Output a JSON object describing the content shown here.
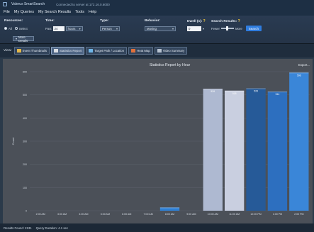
{
  "window": {
    "app_name": "Valerus SmartSearch",
    "connection_status": "Connected to server at 172.16.0.6000"
  },
  "menu": [
    "File",
    "My Queries",
    "My Search Results",
    "Tools",
    "Help"
  ],
  "filters": {
    "resources": {
      "label": "Resources:",
      "options": [
        "All",
        "Select"
      ],
      "selected": "All"
    },
    "time": {
      "label": "Time:",
      "prefix": "Past",
      "amount": "24",
      "unit": "hours"
    },
    "type": {
      "label": "Type:",
      "value": "Person"
    },
    "behavior": {
      "label": "Behavior:",
      "value": "Moving"
    },
    "dwell": {
      "label": "Dwell (s):",
      "value": "0"
    },
    "search_results": {
      "label": "Search Results:",
      "min_label": "Fewer",
      "max_label": "More"
    },
    "search_button": "Search",
    "more_details_button": "More Details"
  },
  "view": {
    "label": "View:",
    "tabs": [
      {
        "label": "Event Thumbnails",
        "icon": "thumbnails-icon",
        "color": "#e3b84a",
        "active": false
      },
      {
        "label": "Statistics Report",
        "icon": "statistics-icon",
        "color": "#d9dde3",
        "active": true
      },
      {
        "label": "Target Path / Location",
        "icon": "target-path-icon",
        "color": "#6fb6e8",
        "active": false
      },
      {
        "label": "Heat Map",
        "icon": "heat-map-icon",
        "color": "#e0703a",
        "active": false
      },
      {
        "label": "Video Summary",
        "icon": "video-summary-icon",
        "color": "#b8c3d0",
        "active": false
      }
    ]
  },
  "report": {
    "export_label": "Export..."
  },
  "chart_data": {
    "type": "bar",
    "title": "Statistics Report by Hour",
    "ylabel": "Count",
    "xlabel": "",
    "ylim": [
      0,
      600
    ],
    "yticks": [
      0,
      100,
      200,
      300,
      400,
      500,
      600
    ],
    "categories": [
      "2:00 AM",
      "3:00 AM",
      "4:00 AM",
      "5:00 AM",
      "6:00 AM",
      "7:00 AM",
      "8:00 AM",
      "9:00 AM",
      "10:00 AM",
      "11:00 AM",
      "12:00 PM",
      "1:00 PM",
      "2:00 PM"
    ],
    "values": [
      0,
      0,
      0,
      0,
      0,
      0,
      14,
      0,
      526,
      518,
      528,
      514,
      596
    ],
    "value_labels": [
      "",
      "",
      "",
      "",
      "",
      "",
      "",
      "",
      "526",
      "518",
      "528",
      "514",
      "596"
    ],
    "bar_colors": [
      "#2e74c4",
      "#2e74c4",
      "#2e74c4",
      "#2e74c4",
      "#2e74c4",
      "#2e74c4",
      "#2e7fd4",
      "#2e74c4",
      "#aeb9d1",
      "#c9cfe0",
      "#265a98",
      "#2d6fbf",
      "#3a86d8"
    ],
    "grid": true
  },
  "status": {
    "results_found": "Results Found: 2131",
    "query_duration": "Query Duration: 4.1 sec"
  }
}
